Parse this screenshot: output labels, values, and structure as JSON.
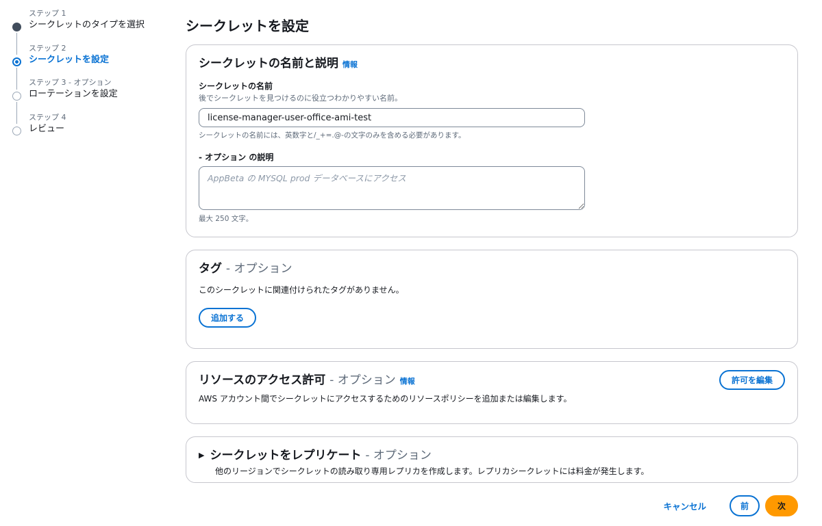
{
  "stepper": {
    "steps": [
      {
        "small": "ステップ 1",
        "label": "シークレットのタイプを選択",
        "state": "done"
      },
      {
        "small": "ステップ 2",
        "label": "シークレットを設定",
        "state": "current"
      },
      {
        "small": "ステップ 3 - オプション",
        "label": "ローテーションを設定",
        "state": "todo"
      },
      {
        "small": "ステップ 4",
        "label": "レビュー",
        "state": "todo"
      }
    ]
  },
  "page": {
    "title": "シークレットを設定"
  },
  "name_panel": {
    "title": "シークレットの名前と説明",
    "info": "情報",
    "name_label": "シークレットの名前",
    "name_desc": "後でシークレットを見つけるのに役立つわかりやすい名前。",
    "name_value": "license-manager-user-office-ami-test",
    "name_hint": "シークレットの名前には、英数字と/_+=.@-の文字のみを含める必要があります。",
    "desc_label": "- オプション の説明",
    "desc_placeholder": "AppBeta の MYSQL prod データベースにアクセス",
    "desc_hint": "最大 250 文字。"
  },
  "tags_panel": {
    "title": "タグ",
    "optional": "- オプション",
    "empty_text": "このシークレットに関連付けられたタグがありません。",
    "add_button": "追加する"
  },
  "access_panel": {
    "title": "リソースのアクセス許可",
    "optional": "- オプション",
    "info": "情報",
    "description": "AWS アカウント間でシークレットにアクセスするためのリソースポリシーを追加または編集します。",
    "edit_button": "許可を編集"
  },
  "replicate_panel": {
    "caret": "▶",
    "title": "シークレットをレプリケート",
    "optional": "- オプション",
    "description": "他のリージョンでシークレットの読み取り専用レプリカを作成します。レプリカシークレットには料金が発生します。"
  },
  "footer": {
    "cancel": "キャンセル",
    "previous": "前",
    "next": "次"
  },
  "colors": {
    "accent": "#0972d3",
    "primary": "#ff9900"
  }
}
